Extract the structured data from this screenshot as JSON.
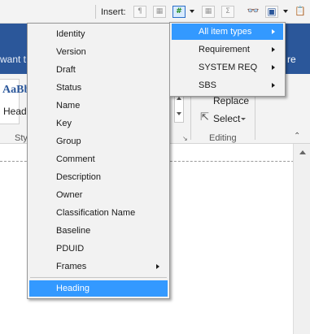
{
  "toolbar": {
    "insert_label": "Insert:",
    "buttons": [
      {
        "name": "paragraph-icon",
        "glyph": "¶"
      },
      {
        "name": "table-icon",
        "glyph": "▦"
      },
      {
        "name": "field-number-icon",
        "glyph": "#"
      },
      {
        "name": "table-grid-icon",
        "glyph": "▦"
      },
      {
        "name": "sum-icon",
        "glyph": "Σ"
      },
      {
        "name": "binoculars-icon",
        "glyph": "👓"
      },
      {
        "name": "layout-icon",
        "glyph": "▣"
      },
      {
        "name": "clipboard-icon",
        "glyph": "📋"
      }
    ]
  },
  "ribbon": {
    "tell_me_text": "want t",
    "share_text": "re",
    "styles_preview": "AaBb",
    "styles_heading": "Head",
    "styles_group_label": "Sty",
    "replace_label": "Replace",
    "replace_icon": "ab ac",
    "select_label": "Select",
    "editing_group_label": "Editing",
    "launcher_icon": "↘",
    "collapse_icon": "⌃"
  },
  "menu_main": {
    "items": [
      {
        "label": "Identity",
        "submenu": false
      },
      {
        "label": "Version",
        "submenu": false
      },
      {
        "label": "Draft",
        "submenu": false
      },
      {
        "label": "Status",
        "submenu": false
      },
      {
        "label": "Name",
        "submenu": false
      },
      {
        "label": "Key",
        "submenu": false
      },
      {
        "label": "Group",
        "submenu": false
      },
      {
        "label": "Comment",
        "submenu": false
      },
      {
        "label": "Description",
        "submenu": false
      },
      {
        "label": "Owner",
        "submenu": false
      },
      {
        "label": "Classification Name",
        "submenu": false
      },
      {
        "label": "Baseline",
        "submenu": false
      },
      {
        "label": "PDUID",
        "submenu": false
      },
      {
        "label": "Frames",
        "submenu": true
      }
    ],
    "highlighted": {
      "label": "Heading",
      "submenu": false
    }
  },
  "menu_sub": {
    "items": [
      {
        "label": "All item types",
        "submenu": true,
        "highlighted": true
      },
      {
        "label": "Requirement",
        "submenu": true,
        "highlighted": false
      },
      {
        "label": "SYSTEM REQ",
        "submenu": true,
        "highlighted": false
      },
      {
        "label": "SBS",
        "submenu": true,
        "highlighted": false
      }
    ]
  },
  "colors": {
    "ribbon_blue": "#2b579a",
    "highlight": "#3399ff",
    "menu_bg": "#f2f2f2"
  }
}
